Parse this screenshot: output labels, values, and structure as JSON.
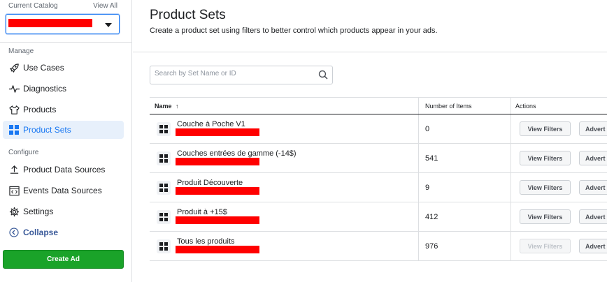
{
  "sidebar": {
    "catalog_label": "Current Catalog",
    "view_all": "View All",
    "manage_label": "Manage",
    "configure_label": "Configure",
    "manage_items": [
      {
        "label": "Use Cases",
        "icon": "rocket-icon"
      },
      {
        "label": "Diagnostics",
        "icon": "pulse-icon"
      },
      {
        "label": "Products",
        "icon": "shirt-icon"
      },
      {
        "label": "Product Sets",
        "icon": "grid-icon",
        "active": true
      }
    ],
    "configure_items": [
      {
        "label": "Product Data Sources",
        "icon": "upload-icon"
      },
      {
        "label": "Events Data Sources",
        "icon": "code-window-icon"
      },
      {
        "label": "Settings",
        "icon": "gear-icon"
      }
    ],
    "collapse_label": "Collapse",
    "create_ad_label": "Create Ad"
  },
  "main": {
    "title": "Product Sets",
    "subtitle": "Create a product set using filters to better control which products appear in your ads.",
    "search_placeholder": "Search by Set Name or ID",
    "table": {
      "headers": {
        "name": "Name",
        "sort_indicator": "↑",
        "items": "Number of Items",
        "actions": "Actions"
      },
      "rows": [
        {
          "name": "Couche à Poche V1",
          "count": "0",
          "view_filters": "View Filters",
          "advert": "Advert",
          "view_disabled": false
        },
        {
          "name": "Couches entrées de gamme (-14$)",
          "count": "541",
          "view_filters": "View Filters",
          "advert": "Advert",
          "view_disabled": false
        },
        {
          "name": "Produit Découverte",
          "count": "9",
          "view_filters": "View Filters",
          "advert": "Advert",
          "view_disabled": false
        },
        {
          "name": "Produit à +15$",
          "count": "412",
          "view_filters": "View Filters",
          "advert": "Advert",
          "view_disabled": false
        },
        {
          "name": "Tous les produits",
          "count": "976",
          "view_filters": "View Filters",
          "advert": "Advert",
          "view_disabled": true
        }
      ]
    }
  },
  "colors": {
    "accent": "#1877f2",
    "create_ad": "#1aa329",
    "redaction": "#ff0000",
    "active_bg": "#e7f0fb"
  }
}
